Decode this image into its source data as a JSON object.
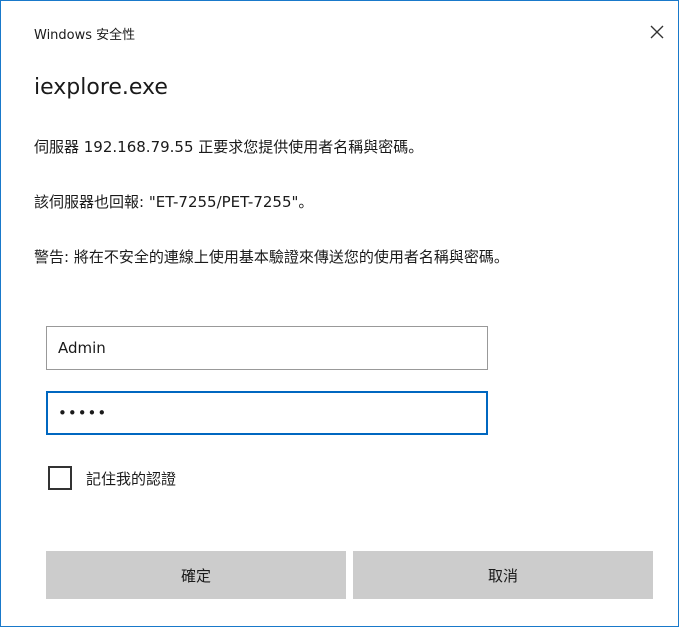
{
  "dialog": {
    "title": "Windows 安全性",
    "app_name": "iexplore.exe",
    "message_server": "伺服器 192.168.79.55 正要求您提供使用者名稱與密碼。",
    "message_realm": "該伺服器也回報: \"ET-7255/PET-7255\"。",
    "message_warning": "警告: 將在不安全的連線上使用基本驗證來傳送您的使用者名稱與密碼。"
  },
  "form": {
    "username_value": "Admin",
    "password_value": "admin",
    "remember_label": "記住我的認證",
    "remember_checked": false
  },
  "buttons": {
    "ok_label": "確定",
    "cancel_label": "取消"
  },
  "icons": {
    "close": "close-icon"
  },
  "colors": {
    "border_accent": "#1979ca",
    "focus_border": "#0067c0",
    "button_bg": "#cccccc"
  }
}
